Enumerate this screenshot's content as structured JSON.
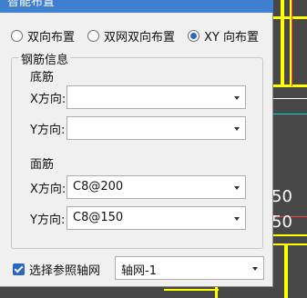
{
  "window": {
    "title": "智能布置"
  },
  "layout_mode": {
    "options": [
      "双向布置",
      "双网双向布置",
      "XY 向布置"
    ],
    "selected_index": 2
  },
  "rebar_group": {
    "title": "钢筋信息",
    "bottom": {
      "label": "底筋",
      "x_label": "X方向:",
      "x_value": "",
      "y_label": "Y方向:",
      "y_value": ""
    },
    "top": {
      "label": "面筋",
      "x_label": "X方向:",
      "x_value": "C8@200",
      "y_label": "Y方向:",
      "y_value": "C8@150"
    }
  },
  "reference_axis": {
    "checkbox_label": "选择参照轴网",
    "checked": true,
    "selected": "轴网-1"
  },
  "background": {
    "texts": [
      "50",
      "50"
    ],
    "colors": {
      "yellow": "#ffff00",
      "red": "#ff3b3b",
      "cyan": "#00d8d8",
      "white": "#ffffff"
    }
  }
}
